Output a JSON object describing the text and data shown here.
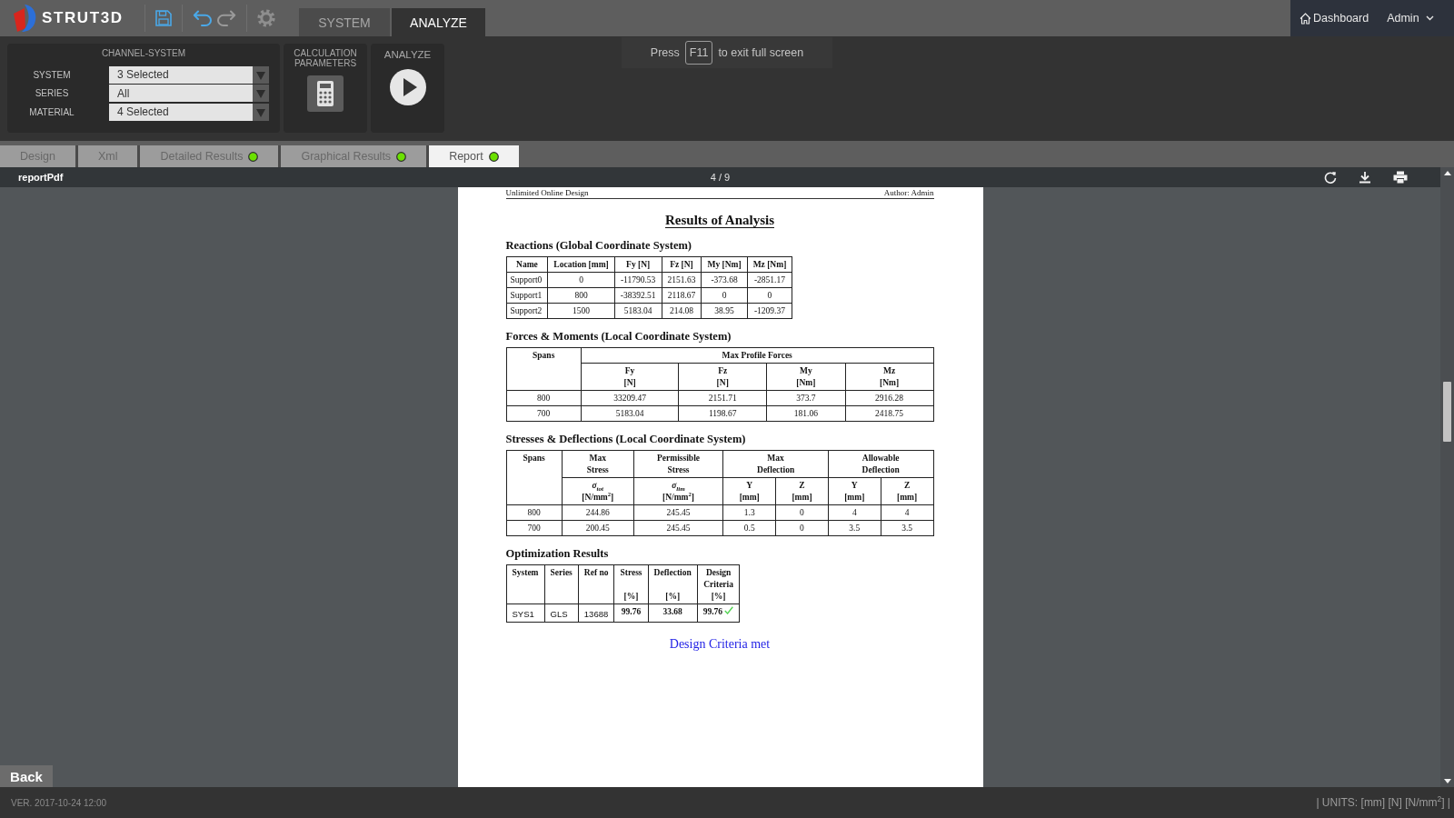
{
  "app_bar": {
    "logo": "STRUT3D",
    "mode_tabs": [
      {
        "label": "SYSTEM",
        "selected": false
      },
      {
        "label": "ANALYZE",
        "selected": true
      }
    ],
    "dashboard_link": "Dashboard",
    "user_menu": "Admin"
  },
  "fullscreen_hint": {
    "before": "Press",
    "key": "F11",
    "after": "to exit full screen"
  },
  "channel_system": {
    "title": "CHANNEL-SYSTEM",
    "fields": [
      {
        "label": "SYSTEM",
        "value": "3 Selected"
      },
      {
        "label": "SERIES",
        "value": "All"
      },
      {
        "label": "MATERIAL",
        "value": "4 Selected"
      }
    ]
  },
  "calculation_parameters": {
    "title": "CALCULATION PARAMETERS"
  },
  "analyze": {
    "title": "ANALYZE"
  },
  "tabs": [
    {
      "label": "Design",
      "selected": false,
      "complete": false
    },
    {
      "label": "Xml",
      "selected": false,
      "complete": false
    },
    {
      "label": "Detailed Results",
      "selected": false,
      "complete": true
    },
    {
      "label": "Graphical Results",
      "selected": false,
      "complete": true
    },
    {
      "label": "Report",
      "selected": true,
      "complete": true
    }
  ],
  "pdf_viewer": {
    "file_name": "reportPdf",
    "page_indicator": "4 / 9",
    "page": {
      "header_left": "Unlimited Online Design",
      "header_right": "Author: Admin",
      "title": "Results of Analysis",
      "sections": [
        {
          "heading": "Reactions (Global Coordinate System)",
          "table": {
            "kind": "reactions",
            "header_rows": [
              [
                {
                  "text": "Name"
                },
                {
                  "text": "Location [mm]"
                },
                {
                  "text": "Fy [N]"
                },
                {
                  "text": "Fz [N]"
                },
                {
                  "text": "My [Nm]"
                },
                {
                  "text": "Mz [Nm]"
                }
              ]
            ],
            "rows": [
              [
                "Support0",
                "0",
                "-11790.53",
                "2151.63",
                "-373.68",
                "-2851.17"
              ],
              [
                "Support1",
                "800",
                "-38392.51",
                "2118.67",
                "0",
                "0"
              ],
              [
                "Support2",
                "1500",
                "5183.04",
                "214.08",
                "38.95",
                "-1209.37"
              ]
            ]
          }
        },
        {
          "heading": "Forces & Moments (Local Coordinate System)",
          "table": {
            "kind": "forces",
            "header_rows": [
              [
                {
                  "text": "Spans",
                  "rowspan": 2
                },
                {
                  "text": "Max Profile Forces",
                  "colspan": 4
                }
              ],
              [
                {
                  "text": "Fy\n[N]"
                },
                {
                  "text": "Fz\n[N]"
                },
                {
                  "text": "My\n[Nm]"
                },
                {
                  "text": "Mz\n[Nm]"
                }
              ]
            ],
            "rows": [
              [
                "800",
                "33209.47",
                "2151.71",
                "373.7",
                "2916.28"
              ],
              [
                "700",
                "5183.04",
                "1198.67",
                "181.06",
                "2418.75"
              ]
            ]
          }
        },
        {
          "heading": "Stresses & Deflections (Local Coordinate System)",
          "table": {
            "kind": "stresses",
            "header_rows": [
              [
                {
                  "text": "Spans",
                  "rowspan": 2
                },
                {
                  "text": "Max\nStress"
                },
                {
                  "text": "Permissible\nStress"
                },
                {
                  "text": "Max\nDeflection",
                  "colspan": 2
                },
                {
                  "text": "Allowable\nDeflection",
                  "colspan": 2
                }
              ],
              [
                {
                  "text": "*σ*$_{tot}$\n[N/mm$^{2}$]"
                },
                {
                  "text": "*σ*$_{lim}$\n[N/mm$^{2}$]"
                },
                {
                  "text": "Y\n[mm]"
                },
                {
                  "text": "Z\n[mm]"
                },
                {
                  "text": "Y\n[mm]"
                },
                {
                  "text": "Z\n[mm]"
                }
              ]
            ],
            "rows": [
              [
                "800",
                "244.86",
                "245.45",
                "1.3",
                "0",
                "4",
                "4"
              ],
              [
                "700",
                "200.45",
                "245.45",
                "0.5",
                "0",
                "3.5",
                "3.5"
              ]
            ]
          }
        },
        {
          "heading": "Optimization Results",
          "table": {
            "kind": "optimization",
            "header_rows": [
              [
                {
                  "text": "System"
                },
                {
                  "text": "Series"
                },
                {
                  "text": "Ref no"
                },
                {
                  "text": "Stress\n\n[%]"
                },
                {
                  "text": "Deflection\n\n[%]"
                },
                {
                  "text": "Design\nCriteria\n[%]"
                }
              ]
            ],
            "rows": [
              [
                {
                  "text": "SYS1",
                  "kind": "input"
                },
                {
                  "text": "GLS",
                  "kind": "input"
                },
                {
                  "text": "13688",
                  "kind": "input"
                },
                {
                  "text": "99.76",
                  "kind": "result"
                },
                {
                  "text": "33.68",
                  "kind": "result"
                },
                {
                  "text": "99.76",
                  "kind": "result",
                  "passed": true
                }
              ]
            ]
          }
        }
      ],
      "conclusion": "Design Criteria met"
    },
    "back_button": "Back"
  },
  "status_bar": {
    "version": "VER. 2017-10-24 12:00",
    "units": "| UNITS: [mm] [N] [N/mm$^{2}$] |"
  }
}
